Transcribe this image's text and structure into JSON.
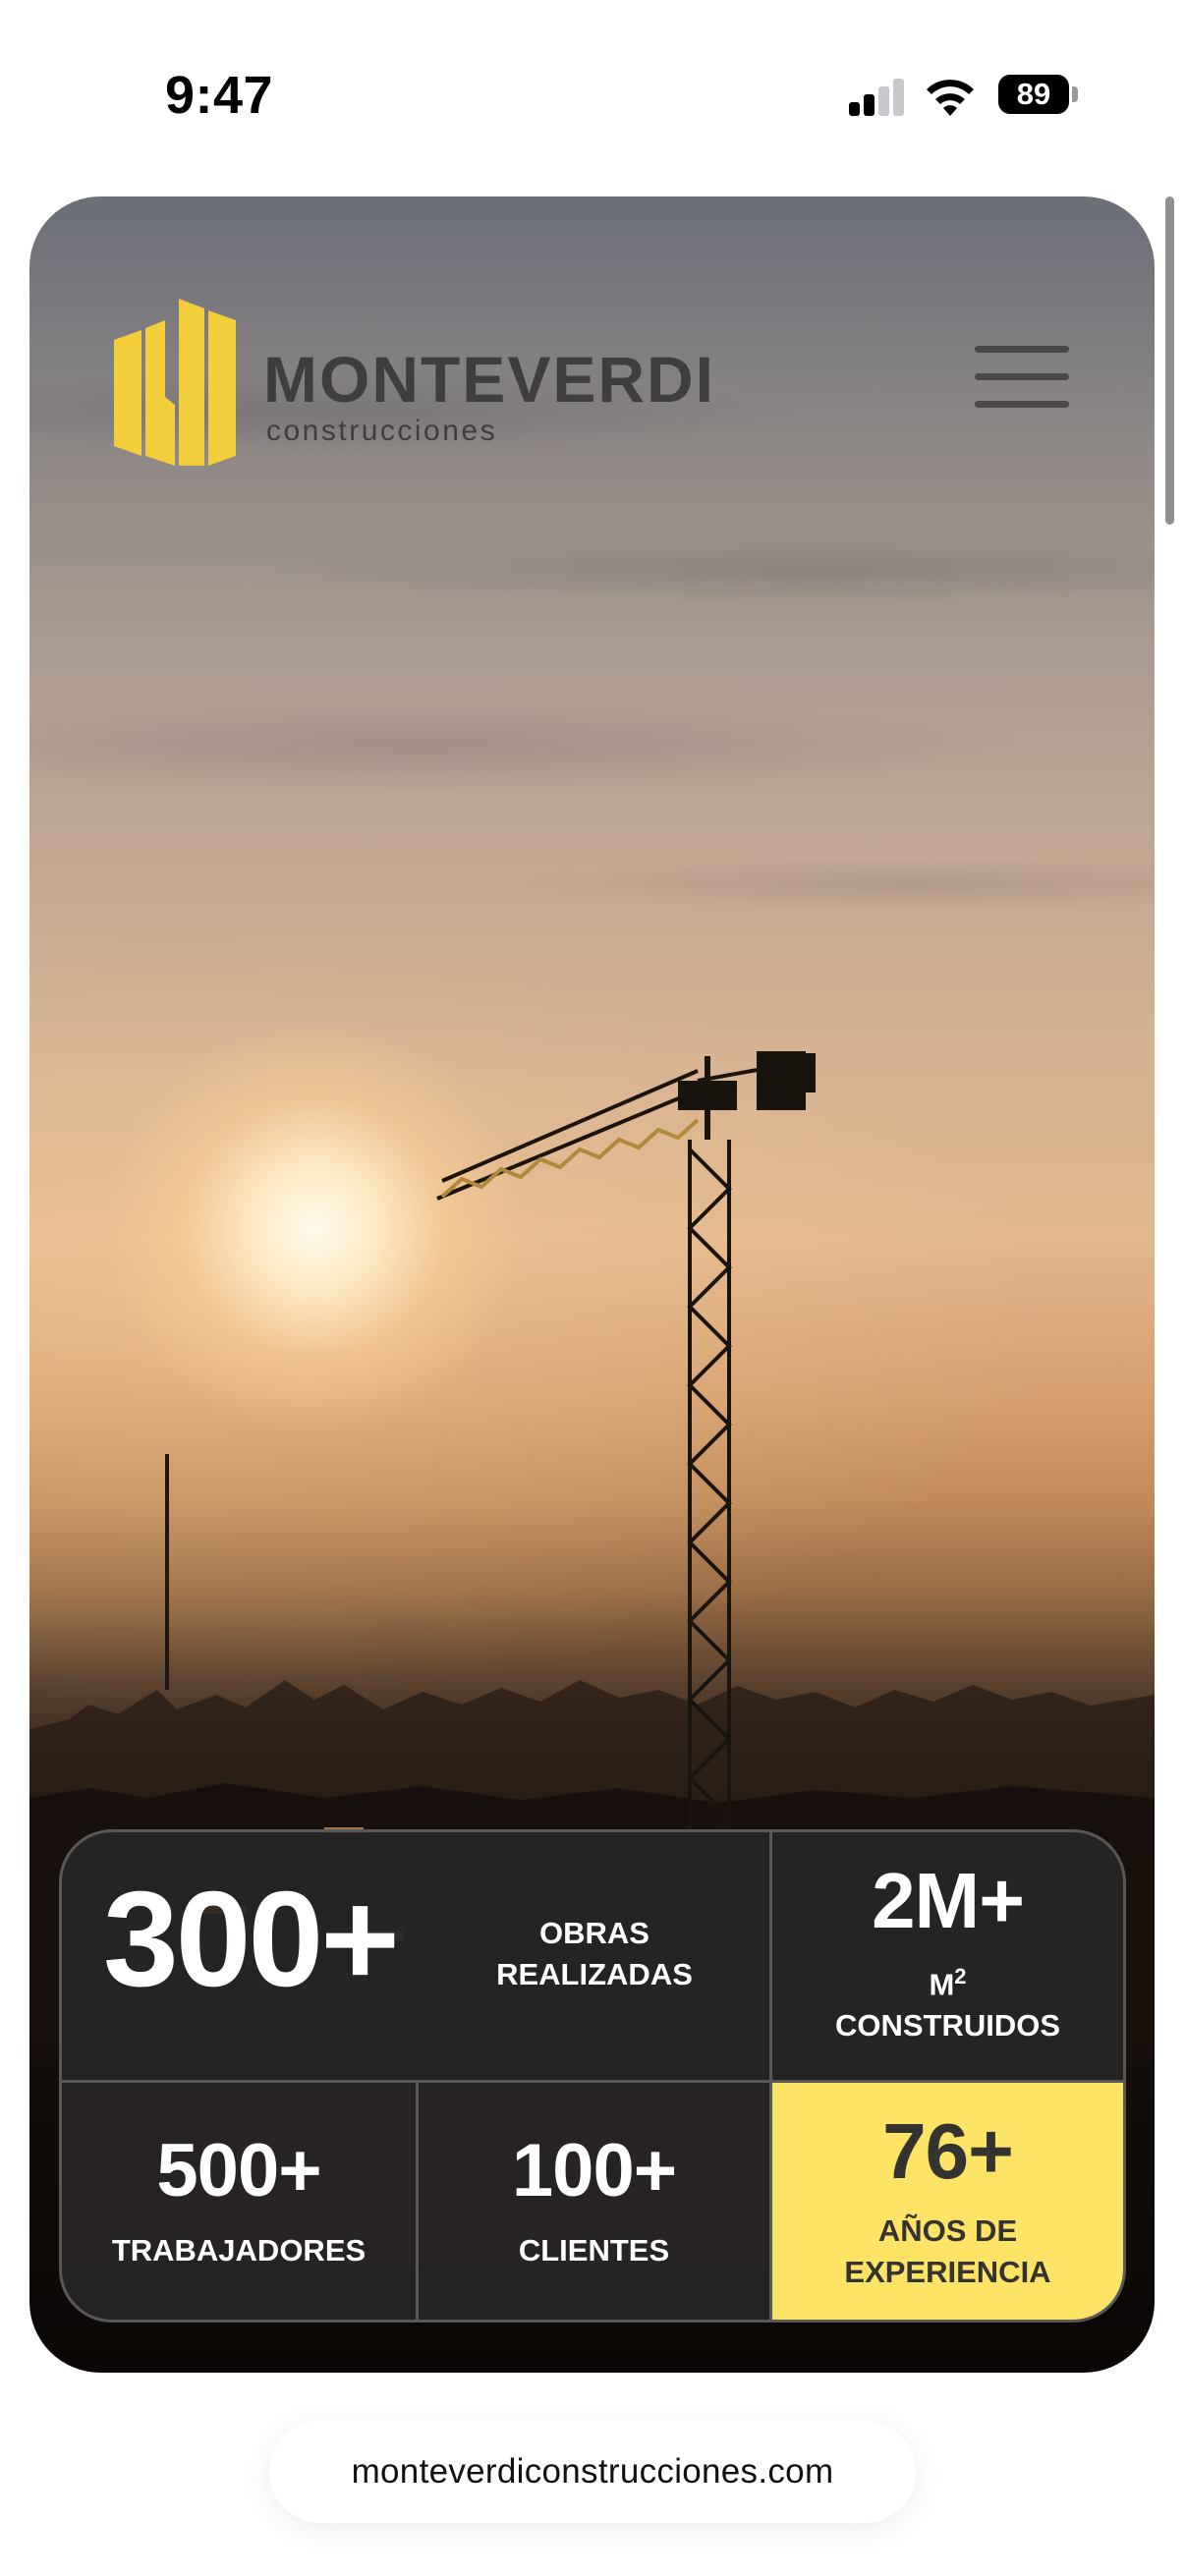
{
  "status_bar": {
    "time": "9:47",
    "battery": "89"
  },
  "brand": {
    "name": "MONTEVERDI",
    "subtitle": "construcciones",
    "logo_color": "#f2cf3a"
  },
  "stats": [
    {
      "value": "300+",
      "label": "OBRAS REALIZADAS"
    },
    {
      "value": "2M+",
      "unit": "M",
      "unit_sup": "2",
      "label": "CONSTRUIDOS"
    },
    {
      "value": "500+",
      "label": "TRABAJADORES"
    },
    {
      "value": "100+",
      "label": "CLIENTES"
    },
    {
      "value": "76+",
      "label": "AÑOS DE EXPERIENCIA",
      "highlight_color": "#fde466"
    }
  ],
  "url_bar": {
    "url": "monteverdiconstrucciones.com"
  }
}
